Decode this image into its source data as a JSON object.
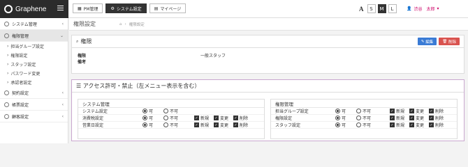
{
  "header": {
    "brand": "Graphene",
    "nav": [
      {
        "label": "PM管理",
        "icon": "grid-icon",
        "active": false
      },
      {
        "label": "システム設定",
        "icon": "gear-icon",
        "active": true
      },
      {
        "label": "マイページ",
        "icon": "user-card-icon",
        "active": false
      }
    ],
    "font_label": "A",
    "font_sizes": [
      "S",
      "M",
      "L"
    ],
    "font_active": "M",
    "user_name": "渋谷　太郎"
  },
  "sidebar": {
    "items": [
      {
        "label": "システム管理",
        "icon": "globe-icon"
      },
      {
        "label": "権限管理",
        "icon": "user-icon",
        "active": true
      },
      {
        "label": "契約設定",
        "icon": "handshake-icon"
      },
      {
        "label": "帳票設定",
        "icon": "wrench-icon"
      },
      {
        "label": "顧客設定",
        "icon": "building-icon"
      }
    ],
    "subitems": [
      "担当グループ設定",
      "権限設定",
      "スタッフ設定",
      "パスワード変更",
      "承認者設定"
    ]
  },
  "page": {
    "title": "権限設定",
    "breadcrumb": "権限設定"
  },
  "detail": {
    "title": "権限",
    "edit_label": "編集",
    "delete_label": "削除",
    "rows": [
      {
        "label": "権限",
        "value": "一般スタッフ"
      },
      {
        "label": "備考",
        "value": ""
      }
    ]
  },
  "access": {
    "title": "アクセス許可・禁止（左メニュー表示を含む）",
    "allow": "可",
    "deny": "不可",
    "checks": [
      "新規",
      "変更",
      "削除"
    ],
    "left_box": {
      "title": "システム管理",
      "rows": [
        {
          "name": "システム設定",
          "checks": false
        },
        {
          "name": "消費税設定",
          "checks": true
        },
        {
          "name": "営業日設定",
          "checks": true
        }
      ]
    },
    "right_box": {
      "title": "権限管理",
      "rows": [
        {
          "name": "担当グループ設定",
          "checks": true
        },
        {
          "name": "権限設定",
          "checks": true
        },
        {
          "name": "スタッフ設定",
          "checks": true
        }
      ]
    }
  }
}
